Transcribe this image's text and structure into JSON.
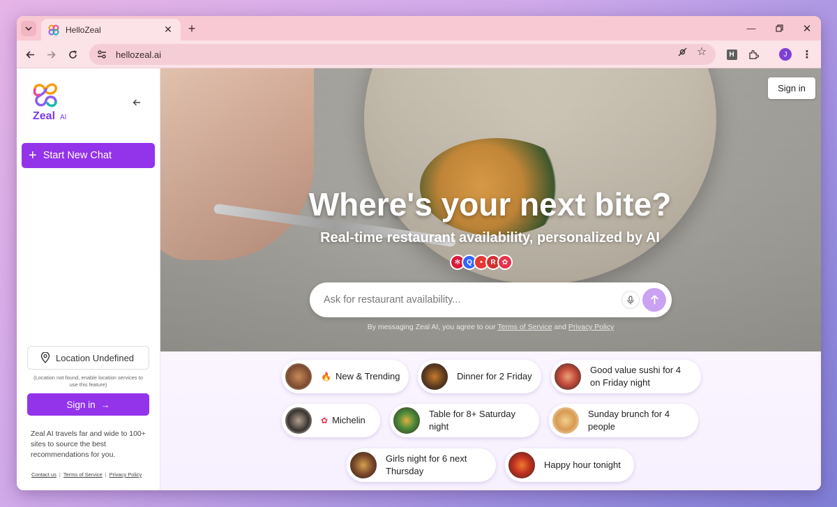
{
  "browser": {
    "tab_title": "HelloZeal",
    "url": "hellozeal.ai",
    "profile_initial": "J",
    "extension_letter": "H"
  },
  "sidebar": {
    "logo_word": "Zeal",
    "logo_suffix": "AI",
    "new_chat_label": "Start New Chat",
    "location_label": "Location Undefined",
    "location_note": "(Location not found, enable location services to use this feature)",
    "signin_label": "Sign in",
    "about_text": "Zeal AI travels far and wide to 100+ sites to source the best recommendations for you.",
    "footer_links": [
      "Contact us",
      "Terms of Service",
      "Privacy Policy"
    ]
  },
  "main": {
    "signin_label": "Sign in",
    "headline": "Where's your next bite?",
    "subheadline": "Real-time restaurant availability, personalized by AI",
    "sources": [
      {
        "letter": "✻",
        "color": "#d81b3a"
      },
      {
        "letter": "Q",
        "color": "#3366ff"
      },
      {
        "letter": "•",
        "color": "#e53935"
      },
      {
        "letter": "R",
        "color": "#d32f2f"
      },
      {
        "letter": "✿",
        "color": "#e8334a"
      }
    ],
    "search_placeholder": "Ask for restaurant availability...",
    "terms_prefix": "By messaging Zeal AI, you agree to our ",
    "terms_link": "Terms of Service",
    "terms_and": " and ",
    "privacy_link": "Privacy Policy"
  },
  "suggestions": [
    {
      "label": "New & Trending",
      "emoji": "🔥"
    },
    {
      "label": "Dinner for 2 Friday"
    },
    {
      "label": "Good value sushi for 4 on Friday night"
    },
    {
      "label": "Michelin",
      "emoji": "✿"
    },
    {
      "label": "Table for 8+ Saturday night"
    },
    {
      "label": "Sunday brunch for 4 people"
    },
    {
      "label": "Girls night for 6 next Thursday"
    },
    {
      "label": "Happy hour tonight"
    }
  ]
}
